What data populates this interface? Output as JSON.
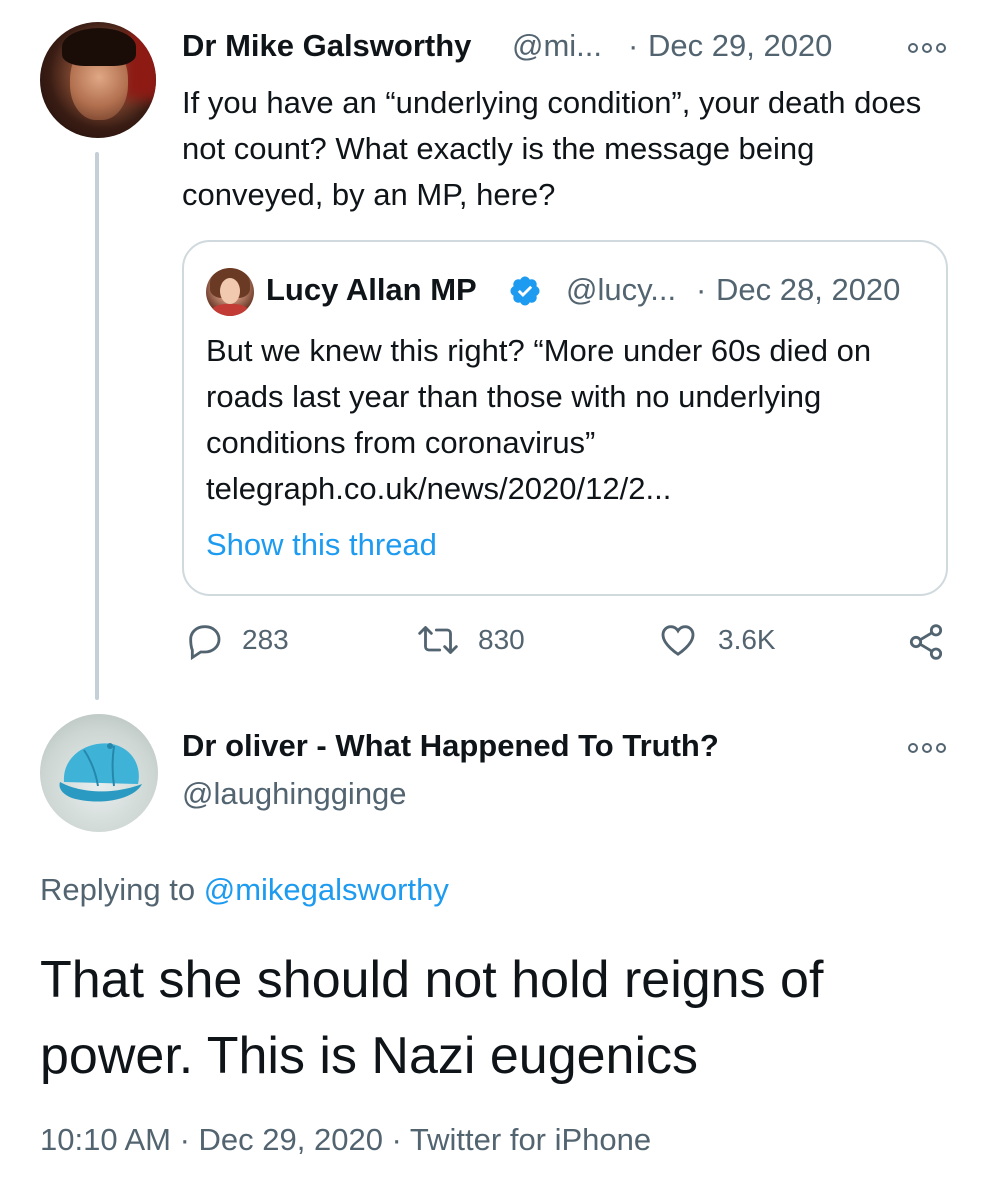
{
  "parent_tweet": {
    "author_name": "Dr Mike Galsworthy",
    "author_handle": "@mi...",
    "separator": "·",
    "date": "Dec 29, 2020",
    "text": "If you have an “underlying condition”, your death does not count? What exactly is the message being conveyed, by an MP, here?",
    "more_icon": "more-icon"
  },
  "quoted_tweet": {
    "author_name": "Lucy Allan MP",
    "verified_icon": "verified-badge-icon",
    "author_handle": "@lucy...",
    "separator": "·",
    "date": "Dec 28, 2020",
    "text": "But we knew this right?  “More under 60s died on roads last year than those with no underlying conditions from coronavirus” telegraph.co.uk/news/2020/12/2...",
    "show_thread": "Show this thread"
  },
  "actions": {
    "reply_count": "283",
    "retweet_count": "830",
    "like_count": "3.6K",
    "icons": [
      "reply-icon",
      "retweet-icon",
      "like-icon",
      "share-icon"
    ]
  },
  "reply_tweet": {
    "author_name": "Dr oliver - What Happened To Truth?",
    "author_handle": "@laughingginge",
    "replying_prefix": "Replying to",
    "replying_mention": "@mikegalsworthy",
    "text": "That she should not hold reigns of power. This is Nazi eugenics",
    "timestamp": "10:10 AM · Dec 29, 2020 · Twitter for iPhone"
  },
  "colors": {
    "text_primary": "#0f1419",
    "text_secondary": "#536471",
    "link": "#1d9bf0",
    "border": "#cfd9de",
    "thread_line": "#c4cfd6"
  }
}
